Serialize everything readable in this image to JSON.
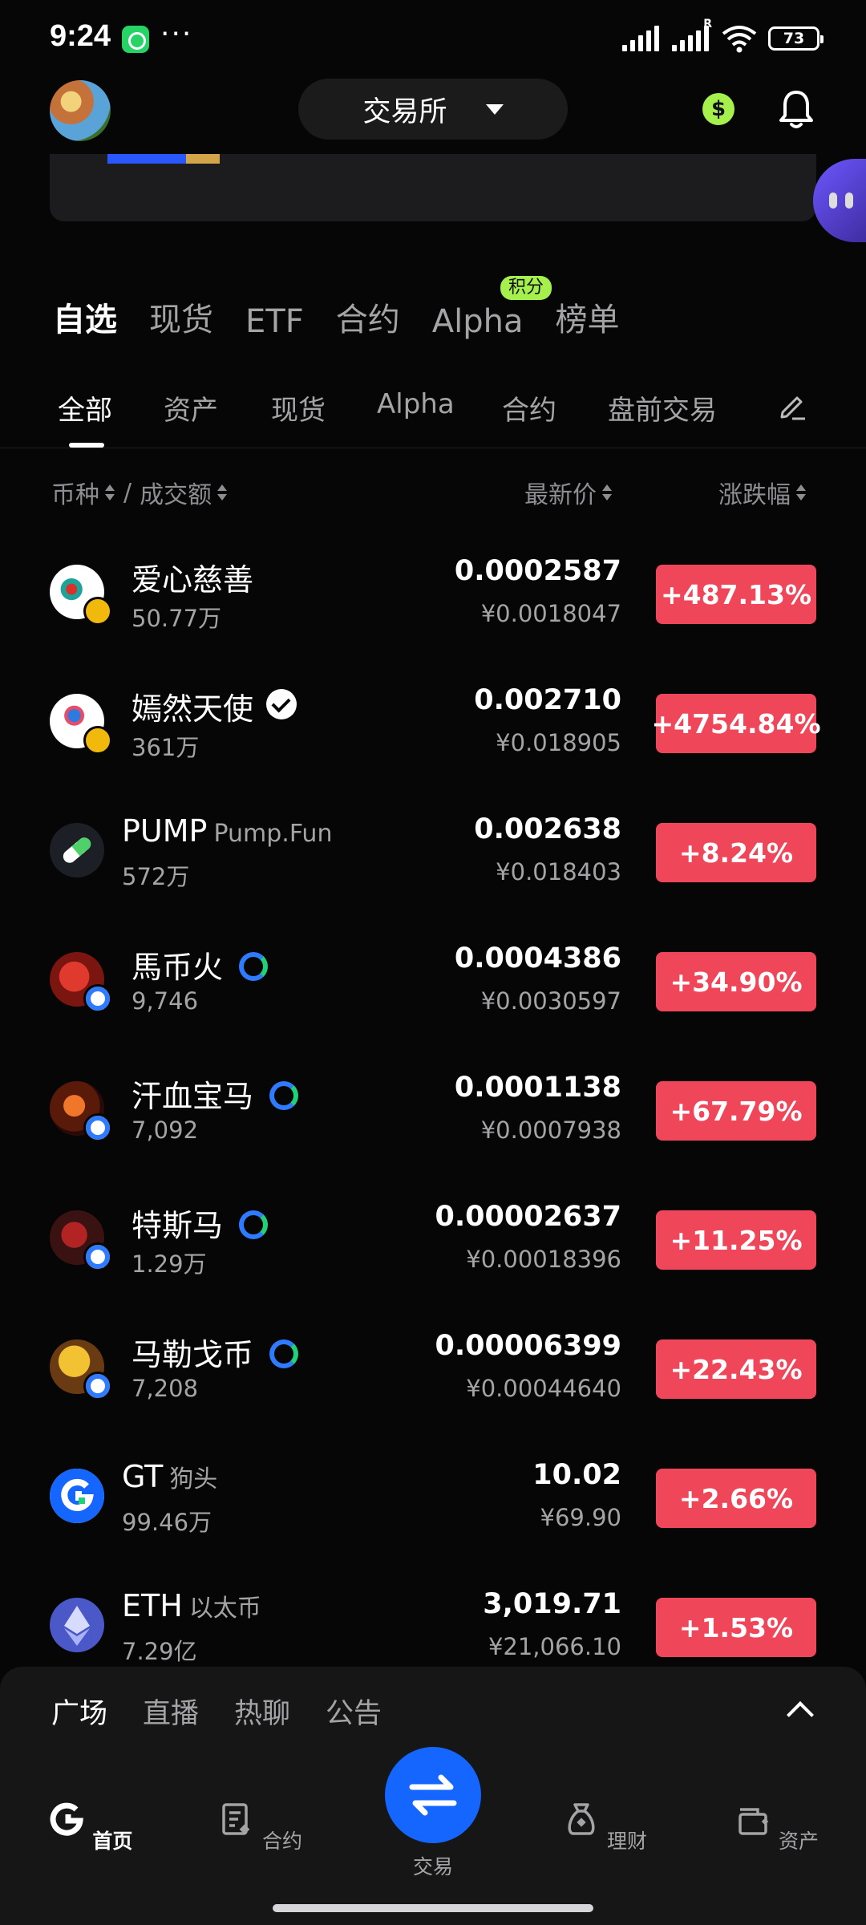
{
  "status_bar": {
    "time": "9:24",
    "battery": "73"
  },
  "header": {
    "exchange_label": "交易所"
  },
  "main_tabs": [
    "自选",
    "现货",
    "ETF",
    "合约",
    "Alpha",
    "榜单"
  ],
  "main_tab_badge": "积分",
  "sub_tabs": [
    "全部",
    "资产",
    "现货",
    "Alpha",
    "合约",
    "盘前交易"
  ],
  "columns": {
    "coin": "币种",
    "sep": "/",
    "volume": "成交额",
    "price": "最新价",
    "change": "涨跌幅"
  },
  "rows": [
    {
      "name": "爱心慈善",
      "sub": "",
      "volume": "50.77万",
      "price": "0.0002587",
      "price_cny": "¥0.0018047",
      "change": "+487.13%",
      "badge": "bnb",
      "verified": false,
      "gate": false
    },
    {
      "name": "嫣然天使",
      "sub": "",
      "volume": "361万",
      "price": "0.002710",
      "price_cny": "¥0.018905",
      "change": "+4754.84%",
      "badge": "bnb",
      "verified": true,
      "gate": false
    },
    {
      "name": "PUMP",
      "sub": "Pump.Fun",
      "volume": "572万",
      "price": "0.002638",
      "price_cny": "¥0.018403",
      "change": "+8.24%",
      "badge": "",
      "verified": false,
      "gate": false
    },
    {
      "name": "馬币火",
      "sub": "",
      "volume": "9,746",
      "price": "0.0004386",
      "price_cny": "¥0.0030597",
      "change": "+34.90%",
      "badge": "gate",
      "verified": false,
      "gate": true
    },
    {
      "name": "汗血宝马",
      "sub": "",
      "volume": "7,092",
      "price": "0.0001138",
      "price_cny": "¥0.0007938",
      "change": "+67.79%",
      "badge": "gate",
      "verified": false,
      "gate": true
    },
    {
      "name": "特斯马",
      "sub": "",
      "volume": "1.29万",
      "price": "0.00002637",
      "price_cny": "¥0.00018396",
      "change": "+11.25%",
      "badge": "gate",
      "verified": false,
      "gate": true
    },
    {
      "name": "马勒戈币",
      "sub": "",
      "volume": "7,208",
      "price": "0.00006399",
      "price_cny": "¥0.00044640",
      "change": "+22.43%",
      "badge": "gate",
      "verified": false,
      "gate": true
    },
    {
      "name": "GT",
      "sub": "狗头",
      "volume": "99.46万",
      "price": "10.02",
      "price_cny": "¥69.90",
      "change": "+2.66%",
      "badge": "",
      "verified": false,
      "gate": false
    },
    {
      "name": "ETH",
      "sub": "以太币",
      "volume": "7.29亿",
      "price": "3,019.71",
      "price_cny": "¥21,066.10",
      "change": "+1.53%",
      "badge": "",
      "verified": false,
      "gate": false
    }
  ],
  "feed_tabs": [
    "广场",
    "直播",
    "热聊",
    "公告"
  ],
  "bottom_nav": {
    "home": "首页",
    "futures": "合约",
    "trade": "交易",
    "earn": "理财",
    "assets": "资产"
  },
  "colors": {
    "up": "#f0465a",
    "accent_blue": "#1565ff",
    "badge_green": "#a6f04d"
  }
}
